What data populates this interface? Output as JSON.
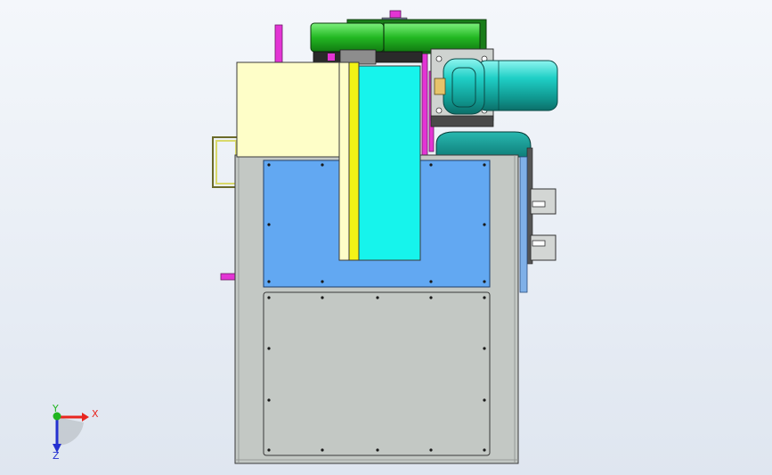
{
  "view": {
    "title": ""
  },
  "triad": {
    "x_label": "X",
    "y_label": "Y",
    "z_label": "Z",
    "colors": {
      "x": "#e8261f",
      "y": "#1fb51f",
      "z": "#2430d0"
    }
  },
  "colors": {
    "frame": "#c3c8c4",
    "window": "#62a8f2",
    "cream_box": "#fefec8",
    "cyan_block": "#16f4ec",
    "yellow_bar": "#f3f316",
    "magenta": "#e334d4",
    "green_pulley": "#2ecc40",
    "motor": "#1bbdb5",
    "outline": "#3a3a3a"
  }
}
